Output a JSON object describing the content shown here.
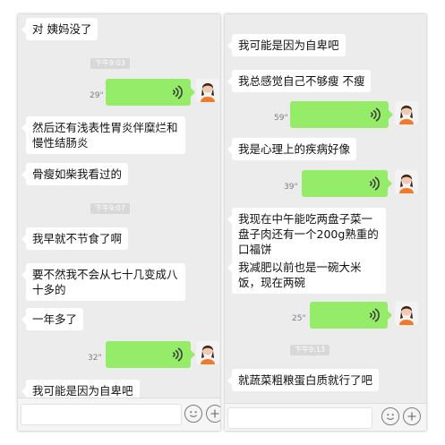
{
  "left": {
    "messages": [
      {
        "text": "对 姨妈没了"
      },
      {
        "time": "下午9:03"
      },
      {
        "duration": "29\""
      },
      {
        "text": "然后还有浅表性胃炎伴糜烂和慢性结肠炎"
      },
      {
        "text": "骨瘦如柴我看过的"
      },
      {
        "time": "下午9:07"
      },
      {
        "text": "我早就不节食了啊"
      },
      {
        "text": "要不然我不会从七十几变成八十多的"
      },
      {
        "text": "一年多了"
      },
      {
        "duration": "32\""
      },
      {
        "text": "我可能是因为自卑吧"
      }
    ]
  },
  "right": {
    "messages": [
      {
        "text": "我可能是因为自卑吧"
      },
      {
        "text": "我总感觉自己不够瘦 不瘦"
      },
      {
        "duration": "59\""
      },
      {
        "text": "我是心理上的疾病好像"
      },
      {
        "duration": "39\""
      },
      {
        "text": "我现在中午能吃两盘子菜一盘子肉还有一个200g熟重的口福饼"
      },
      {
        "text": "我减肥以前也是一碗大米饭，现在两碗"
      },
      {
        "duration": "25\""
      },
      {
        "time": "下午9:13"
      },
      {
        "text": "就蔬菜粗粮蛋白质就行了吧"
      }
    ]
  },
  "icons": {
    "voice": "voice-wave-icon",
    "emoji": "emoji-icon",
    "plus": "plus-icon",
    "avatar": "avatar-icon"
  },
  "colors": {
    "chat_background": "#ececec",
    "incoming_bubble": "#ffffff",
    "outgoing_bubble": "#95ec69",
    "timestamp_chip": "#d8d8d8"
  }
}
